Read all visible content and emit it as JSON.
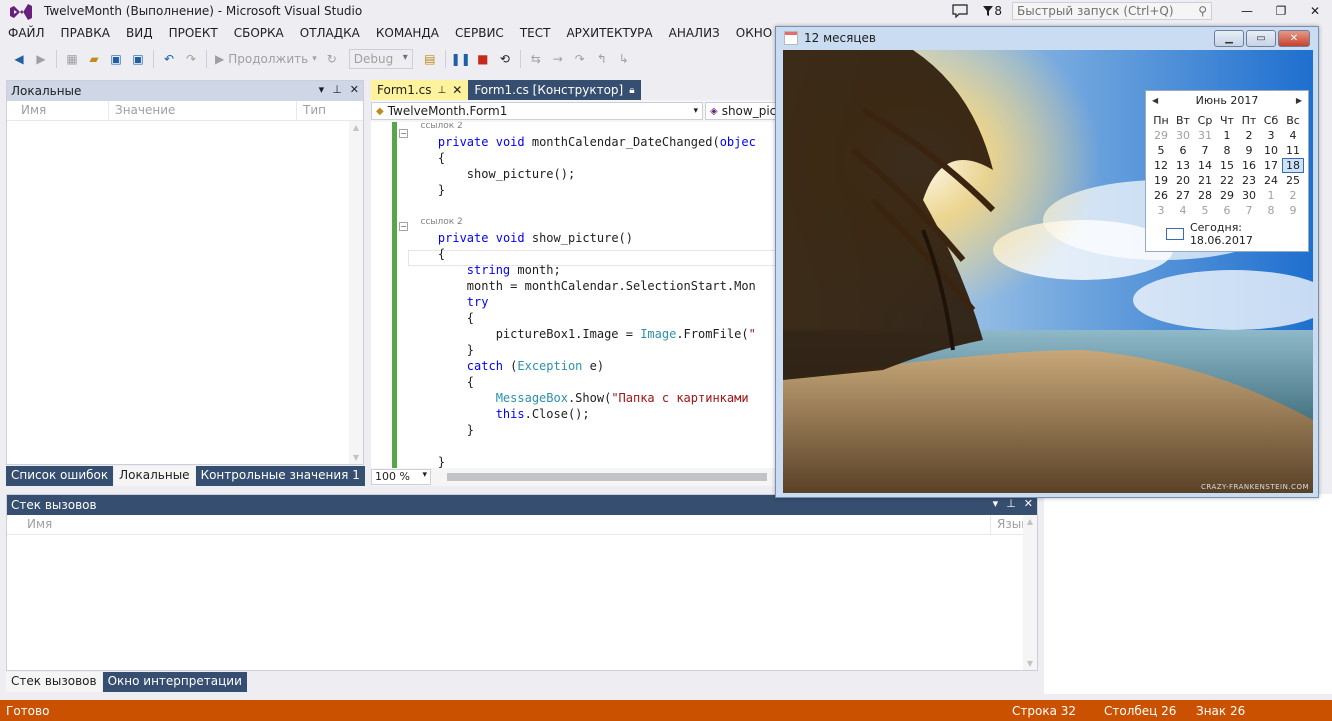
{
  "window": {
    "title": "TwelveMonth (Выполнение) - Microsoft Visual Studio",
    "notification_count": "8",
    "quick_launch_placeholder": "Быстрый запуск (Ctrl+Q)"
  },
  "menu": [
    "ФАЙЛ",
    "ПРАВКА",
    "ВИД",
    "ПРОЕКТ",
    "СБОРКА",
    "ОТЛАДКА",
    "КОМАНДА",
    "СЕРВИС",
    "ТЕСТ",
    "АРХИТЕКТУРА",
    "АНАЛИЗ",
    "ОКНО"
  ],
  "toolbar": {
    "continue_label": "Продолжить",
    "config": "Debug"
  },
  "locals": {
    "title": "Локальные",
    "columns": [
      "Имя",
      "Значение",
      "Тип"
    ]
  },
  "locals_tabs": [
    "Список ошибок",
    "Локальные",
    "Контрольные значения 1"
  ],
  "editor": {
    "tabs": [
      {
        "label": "Form1.cs",
        "active": true
      },
      {
        "label": "Form1.cs [Конструктор]",
        "active": false
      }
    ],
    "class_combo": "TwelveMonth.Form1",
    "member_combo": "show_pic",
    "zoom": "100 %",
    "lines": [
      {
        "cls": "small",
        "text": "ссылок 2"
      },
      {
        "html": "<span class='kw'>private</span> <span class='kw'>void</span> monthCalendar_DateChanged(<span class='kw'>objec</span>"
      },
      {
        "text": "{"
      },
      {
        "text": "    show_picture();"
      },
      {
        "text": "}"
      },
      {
        "text": ""
      },
      {
        "cls": "small",
        "text": "ссылок 2"
      },
      {
        "html": "<span class='kw'>private</span> <span class='kw'>void</span> show_picture()"
      },
      {
        "text": "{"
      },
      {
        "html": "    <span class='kw'>string</span> month;"
      },
      {
        "text": "    month = monthCalendar.SelectionStart.Mon"
      },
      {
        "html": "    <span class='kw'>try</span>"
      },
      {
        "text": "    {"
      },
      {
        "html": "        pictureBox1.Image = <span class='ty'>Image</span>.FromFile(<span class='st'>\"</span>"
      },
      {
        "text": "    }"
      },
      {
        "html": "    <span class='kw'>catch</span> (<span class='ty'>Exception</span> e)"
      },
      {
        "text": "    {"
      },
      {
        "html": "        <span class='ty'>MessageBox</span>.Show(<span class='st'>\"Папка с картинками</span>"
      },
      {
        "html": "        <span class='kw'>this</span>.Close();"
      },
      {
        "text": "    }"
      },
      {
        "text": ""
      },
      {
        "text": "}"
      }
    ]
  },
  "callstack": {
    "title": "Стек вызовов",
    "columns": [
      "Имя",
      "Язык"
    ]
  },
  "callstack_tabs": [
    "Стек вызовов",
    "Окно интерпретации"
  ],
  "status": {
    "ready": "Готово",
    "line": "Строка 32",
    "column": "Столбец 26",
    "char": "Знак 26"
  },
  "form": {
    "title": "12 месяцев",
    "watermark": "CRAZY-FRANKENSTEIN.COM",
    "calendar": {
      "month_label": "Июнь 2017",
      "weekdays": [
        "Пн",
        "Вт",
        "Ср",
        "Чт",
        "Пт",
        "Сб",
        "Вс"
      ],
      "weeks": [
        [
          "29",
          "30",
          "31",
          "1",
          "2",
          "3",
          "4"
        ],
        [
          "5",
          "6",
          "7",
          "8",
          "9",
          "10",
          "11"
        ],
        [
          "12",
          "13",
          "14",
          "15",
          "16",
          "17",
          "18"
        ],
        [
          "19",
          "20",
          "21",
          "22",
          "23",
          "24",
          "25"
        ],
        [
          "26",
          "27",
          "28",
          "29",
          "30",
          "1",
          "2"
        ],
        [
          "3",
          "4",
          "5",
          "6",
          "7",
          "8",
          "9"
        ]
      ],
      "selected": "18",
      "today_label": "Сегодня: 18.06.2017"
    }
  }
}
